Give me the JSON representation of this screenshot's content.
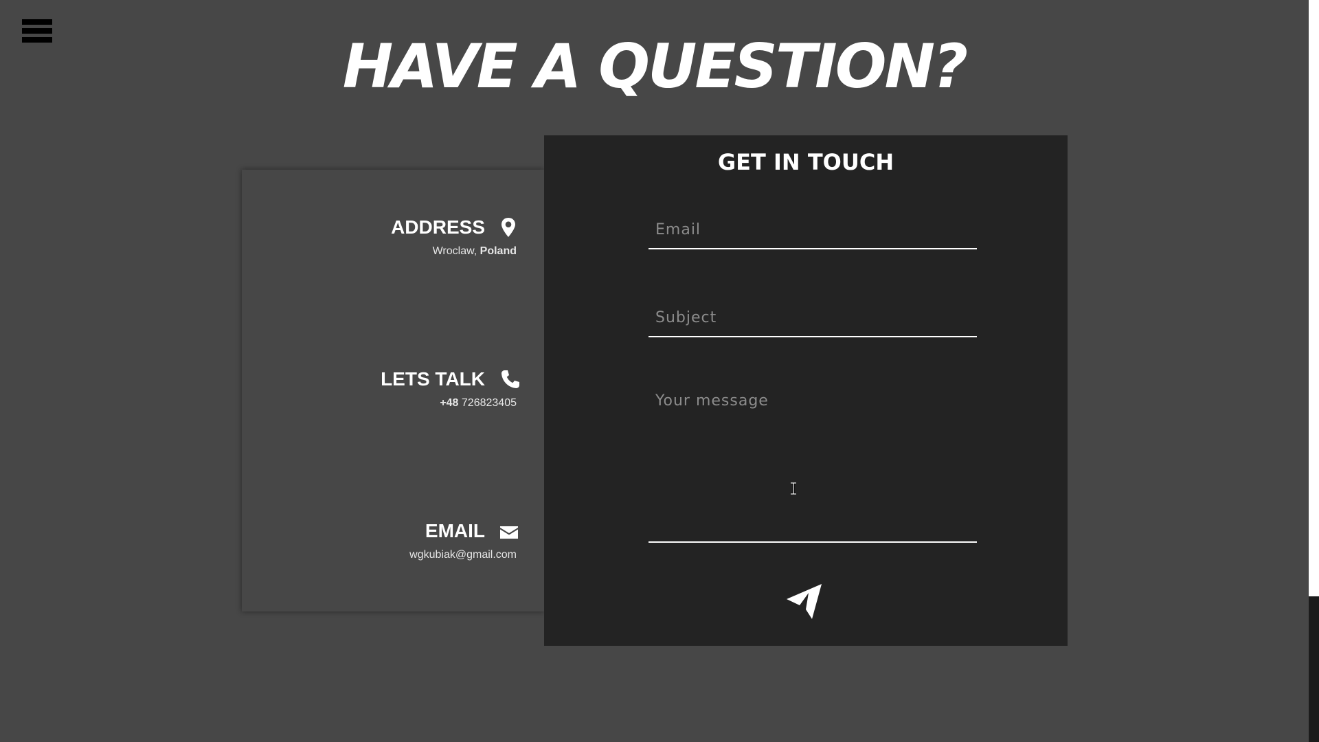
{
  "nav": {
    "menu_icon": "hamburger-menu-icon"
  },
  "page": {
    "title": "HAVE A QUESTION?"
  },
  "info": {
    "address": {
      "title": "ADDRESS",
      "city": "Wroclaw,",
      "country": "Poland",
      "icon": "map-pin-icon"
    },
    "phone": {
      "title": "LETS TALK",
      "prefix": "+48",
      "number": "726823405",
      "icon": "phone-icon"
    },
    "email": {
      "title": "EMAIL",
      "value": "wgkubiak@gmail.com",
      "icon": "envelope-icon"
    }
  },
  "form": {
    "title": "GET IN TOUCH",
    "email_placeholder": "Email",
    "email_value": "",
    "subject_placeholder": "Subject",
    "subject_value": "",
    "message_placeholder": "Your message",
    "message_value": "",
    "send_icon": "paper-plane-icon"
  },
  "colors": {
    "page_background": "#474747",
    "form_background": "#232323",
    "text": "#ffffff",
    "placeholder": "#8c8c8c",
    "menu_icon": "#000000"
  }
}
